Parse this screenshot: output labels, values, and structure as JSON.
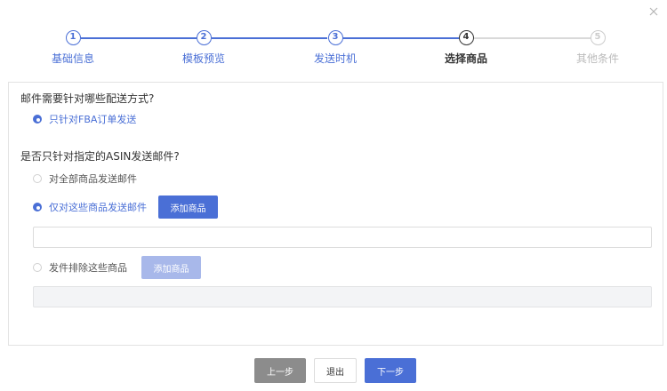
{
  "steps": [
    {
      "num": "1",
      "label": "基础信息",
      "state": "done"
    },
    {
      "num": "2",
      "label": "模板预览",
      "state": "done"
    },
    {
      "num": "3",
      "label": "发送时机",
      "state": "done"
    },
    {
      "num": "4",
      "label": "选择商品",
      "state": "current"
    },
    {
      "num": "5",
      "label": "其他条件",
      "state": "future"
    }
  ],
  "colors": {
    "accent": "#4a6fd6",
    "inactive": "#cccccc",
    "prev_button": "#8c8c8c"
  },
  "delivery": {
    "question": "邮件需要针对哪些配送方式?",
    "options": [
      {
        "label": "只针对FBA订单发送",
        "selected": true
      }
    ]
  },
  "asin": {
    "question": "是否只针对指定的ASIN发送邮件?",
    "options": [
      {
        "label": "对全部商品发送邮件",
        "selected": false
      },
      {
        "label": "仅对这些商品发送邮件",
        "selected": true,
        "button": "添加商品"
      },
      {
        "label": "发件排除这些商品",
        "selected": false,
        "button": "添加商品"
      }
    ]
  },
  "footer": {
    "prev": "上一步",
    "exit": "退出",
    "next": "下一步"
  },
  "icons": {
    "close": "close-icon"
  }
}
